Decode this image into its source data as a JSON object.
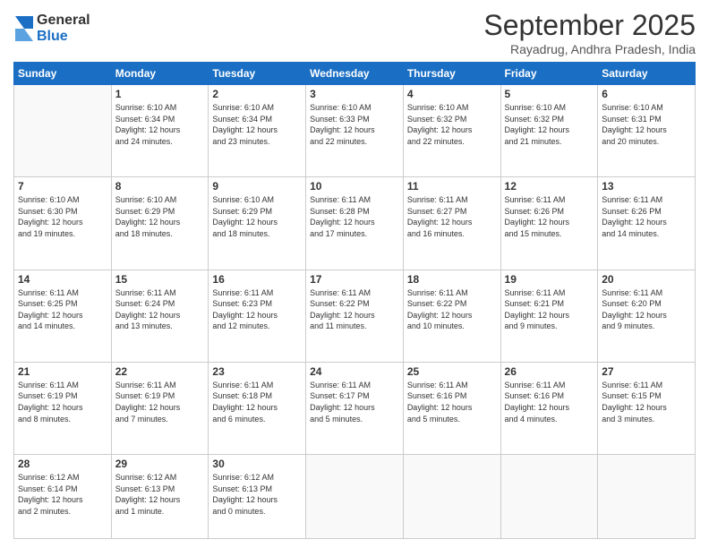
{
  "logo": {
    "general": "General",
    "blue": "Blue"
  },
  "title": "September 2025",
  "subtitle": "Rayadrug, Andhra Pradesh, India",
  "days_header": [
    "Sunday",
    "Monday",
    "Tuesday",
    "Wednesday",
    "Thursday",
    "Friday",
    "Saturday"
  ],
  "weeks": [
    [
      {
        "day": "",
        "info": ""
      },
      {
        "day": "1",
        "info": "Sunrise: 6:10 AM\nSunset: 6:34 PM\nDaylight: 12 hours\nand 24 minutes."
      },
      {
        "day": "2",
        "info": "Sunrise: 6:10 AM\nSunset: 6:34 PM\nDaylight: 12 hours\nand 23 minutes."
      },
      {
        "day": "3",
        "info": "Sunrise: 6:10 AM\nSunset: 6:33 PM\nDaylight: 12 hours\nand 22 minutes."
      },
      {
        "day": "4",
        "info": "Sunrise: 6:10 AM\nSunset: 6:32 PM\nDaylight: 12 hours\nand 22 minutes."
      },
      {
        "day": "5",
        "info": "Sunrise: 6:10 AM\nSunset: 6:32 PM\nDaylight: 12 hours\nand 21 minutes."
      },
      {
        "day": "6",
        "info": "Sunrise: 6:10 AM\nSunset: 6:31 PM\nDaylight: 12 hours\nand 20 minutes."
      }
    ],
    [
      {
        "day": "7",
        "info": "Sunrise: 6:10 AM\nSunset: 6:30 PM\nDaylight: 12 hours\nand 19 minutes."
      },
      {
        "day": "8",
        "info": "Sunrise: 6:10 AM\nSunset: 6:29 PM\nDaylight: 12 hours\nand 18 minutes."
      },
      {
        "day": "9",
        "info": "Sunrise: 6:10 AM\nSunset: 6:29 PM\nDaylight: 12 hours\nand 18 minutes."
      },
      {
        "day": "10",
        "info": "Sunrise: 6:11 AM\nSunset: 6:28 PM\nDaylight: 12 hours\nand 17 minutes."
      },
      {
        "day": "11",
        "info": "Sunrise: 6:11 AM\nSunset: 6:27 PM\nDaylight: 12 hours\nand 16 minutes."
      },
      {
        "day": "12",
        "info": "Sunrise: 6:11 AM\nSunset: 6:26 PM\nDaylight: 12 hours\nand 15 minutes."
      },
      {
        "day": "13",
        "info": "Sunrise: 6:11 AM\nSunset: 6:26 PM\nDaylight: 12 hours\nand 14 minutes."
      }
    ],
    [
      {
        "day": "14",
        "info": "Sunrise: 6:11 AM\nSunset: 6:25 PM\nDaylight: 12 hours\nand 14 minutes."
      },
      {
        "day": "15",
        "info": "Sunrise: 6:11 AM\nSunset: 6:24 PM\nDaylight: 12 hours\nand 13 minutes."
      },
      {
        "day": "16",
        "info": "Sunrise: 6:11 AM\nSunset: 6:23 PM\nDaylight: 12 hours\nand 12 minutes."
      },
      {
        "day": "17",
        "info": "Sunrise: 6:11 AM\nSunset: 6:22 PM\nDaylight: 12 hours\nand 11 minutes."
      },
      {
        "day": "18",
        "info": "Sunrise: 6:11 AM\nSunset: 6:22 PM\nDaylight: 12 hours\nand 10 minutes."
      },
      {
        "day": "19",
        "info": "Sunrise: 6:11 AM\nSunset: 6:21 PM\nDaylight: 12 hours\nand 9 minutes."
      },
      {
        "day": "20",
        "info": "Sunrise: 6:11 AM\nSunset: 6:20 PM\nDaylight: 12 hours\nand 9 minutes."
      }
    ],
    [
      {
        "day": "21",
        "info": "Sunrise: 6:11 AM\nSunset: 6:19 PM\nDaylight: 12 hours\nand 8 minutes."
      },
      {
        "day": "22",
        "info": "Sunrise: 6:11 AM\nSunset: 6:19 PM\nDaylight: 12 hours\nand 7 minutes."
      },
      {
        "day": "23",
        "info": "Sunrise: 6:11 AM\nSunset: 6:18 PM\nDaylight: 12 hours\nand 6 minutes."
      },
      {
        "day": "24",
        "info": "Sunrise: 6:11 AM\nSunset: 6:17 PM\nDaylight: 12 hours\nand 5 minutes."
      },
      {
        "day": "25",
        "info": "Sunrise: 6:11 AM\nSunset: 6:16 PM\nDaylight: 12 hours\nand 5 minutes."
      },
      {
        "day": "26",
        "info": "Sunrise: 6:11 AM\nSunset: 6:16 PM\nDaylight: 12 hours\nand 4 minutes."
      },
      {
        "day": "27",
        "info": "Sunrise: 6:11 AM\nSunset: 6:15 PM\nDaylight: 12 hours\nand 3 minutes."
      }
    ],
    [
      {
        "day": "28",
        "info": "Sunrise: 6:12 AM\nSunset: 6:14 PM\nDaylight: 12 hours\nand 2 minutes."
      },
      {
        "day": "29",
        "info": "Sunrise: 6:12 AM\nSunset: 6:13 PM\nDaylight: 12 hours\nand 1 minute."
      },
      {
        "day": "30",
        "info": "Sunrise: 6:12 AM\nSunset: 6:13 PM\nDaylight: 12 hours\nand 0 minutes."
      },
      {
        "day": "",
        "info": ""
      },
      {
        "day": "",
        "info": ""
      },
      {
        "day": "",
        "info": ""
      },
      {
        "day": "",
        "info": ""
      }
    ]
  ]
}
